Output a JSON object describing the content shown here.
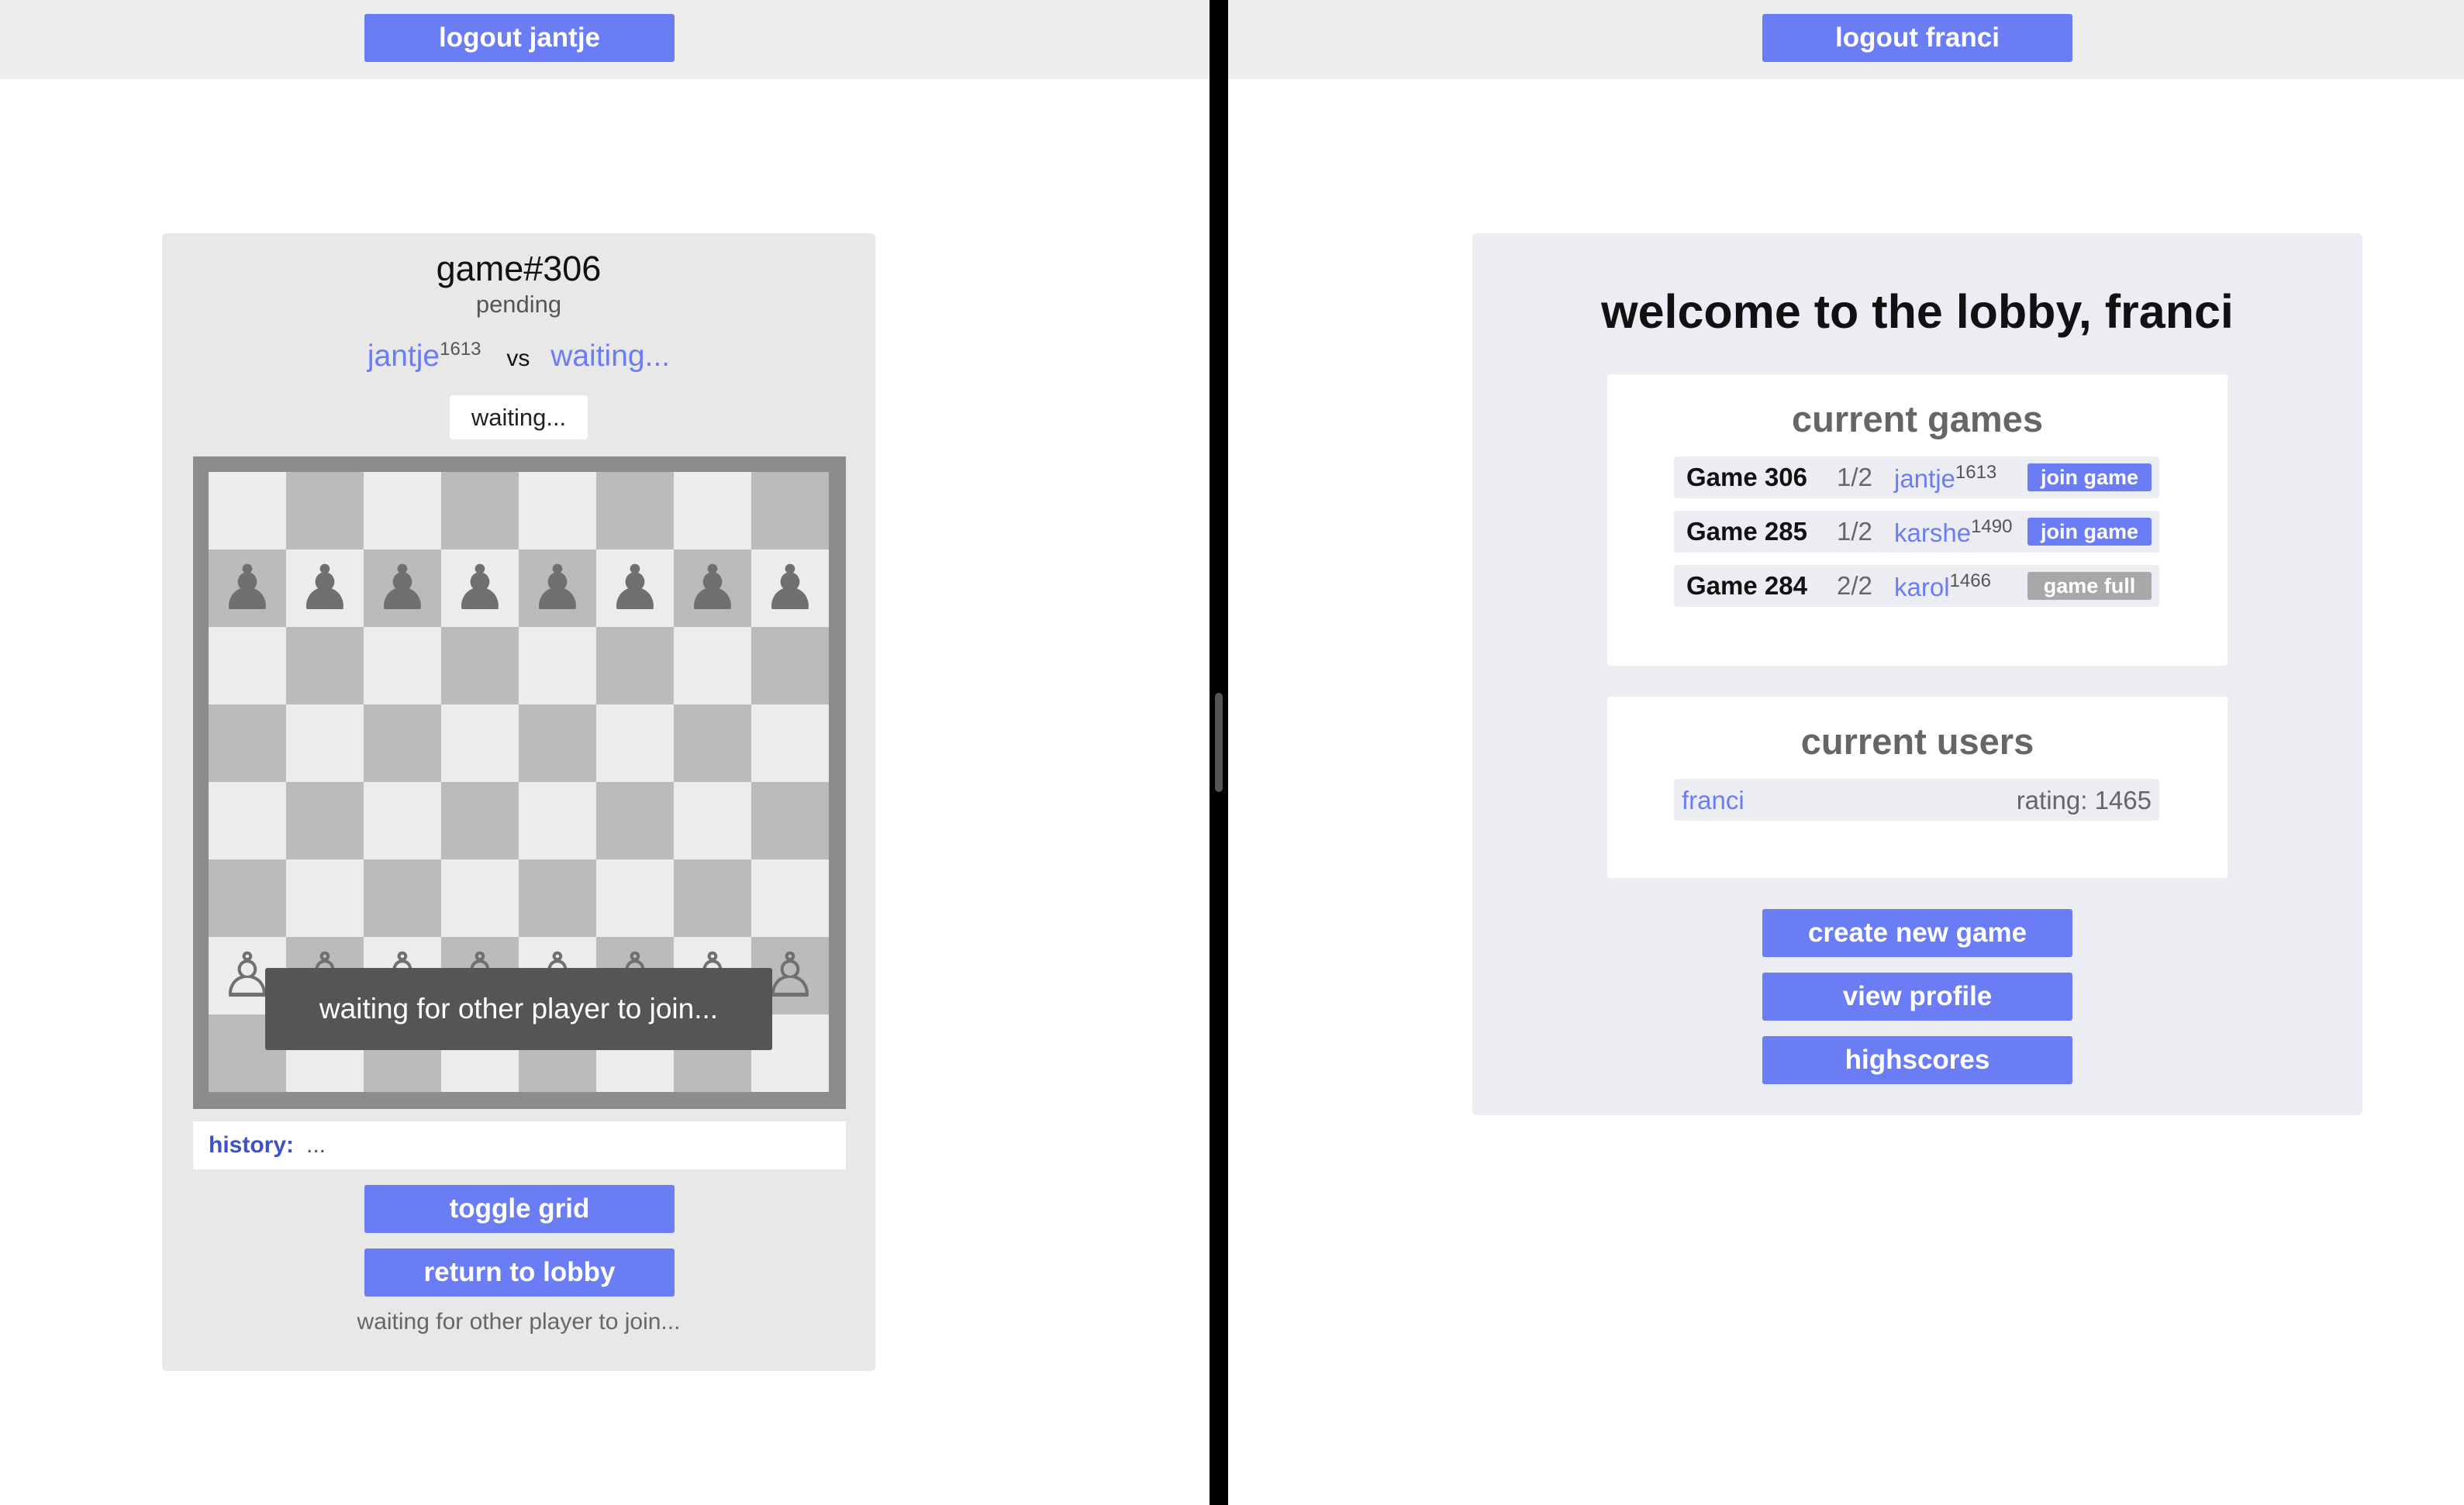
{
  "left": {
    "logout_label": "logout jantje",
    "game": {
      "title": "game#306",
      "status": "pending",
      "player1": "jantje",
      "player1_rating": "1613",
      "vs": "vs",
      "player2": "waiting...",
      "wait_tag": "waiting...",
      "overlay": "waiting for other player to join...",
      "history_label": "history:",
      "history_value": "...",
      "toggle_grid_label": "toggle grid",
      "return_lobby_label": "return to lobby",
      "footer_message": "waiting for other player to join..."
    },
    "board": {
      "rows": [
        [
          "",
          "",
          "",
          "",
          "",
          "",
          "",
          ""
        ],
        [
          "♟",
          "♟",
          "♟",
          "♟",
          "♟",
          "♟",
          "♟",
          "♟"
        ],
        [
          "",
          "",
          "",
          "",
          "",
          "",
          "",
          ""
        ],
        [
          "",
          "",
          "",
          "",
          "",
          "",
          "",
          ""
        ],
        [
          "",
          "",
          "",
          "",
          "",
          "",
          "",
          ""
        ],
        [
          "",
          "",
          "",
          "",
          "",
          "",
          "",
          ""
        ],
        [
          "♙",
          "♙",
          "♙",
          "♙",
          "♙",
          "♙",
          "♙",
          "♙"
        ],
        [
          "",
          "",
          "",
          "",
          "",
          "",
          "",
          ""
        ]
      ]
    }
  },
  "right": {
    "logout_label": "logout franci",
    "lobby_title": "welcome to the lobby, franci",
    "current_games_title": "current games",
    "games": [
      {
        "name": "Game 306",
        "count": "1/2",
        "player": "jantje",
        "rating": "1613",
        "action": "join game",
        "full": false
      },
      {
        "name": "Game 285",
        "count": "1/2",
        "player": "karshe",
        "rating": "1490",
        "action": "join game",
        "full": false
      },
      {
        "name": "Game 284",
        "count": "2/2",
        "player": "karol",
        "rating": "1466",
        "action": "game full",
        "full": true
      }
    ],
    "current_users_title": "current users",
    "users": [
      {
        "name": "franci",
        "rating": "rating: 1465"
      }
    ],
    "create_game_label": "create new game",
    "view_profile_label": "view profile",
    "highscores_label": "highscores"
  },
  "colors": {
    "accent": "#6a7df5",
    "disabled": "#a8a8a8",
    "board_light": "#ececec",
    "board_dark": "#bbbbbb"
  }
}
